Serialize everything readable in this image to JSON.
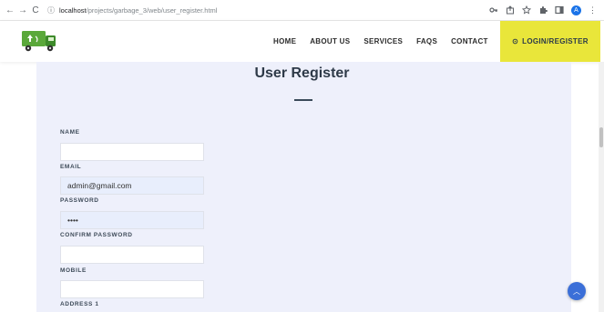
{
  "browser": {
    "back_icon": "←",
    "forward_icon": "→",
    "reload_icon": "C",
    "info_icon": "ⓘ",
    "url_host": "localhost",
    "url_path": "/projects/garbage_3/web/user_register.html",
    "icons": [
      "key",
      "share",
      "star",
      "puzzle",
      "sidebar"
    ],
    "profile_initial": "A"
  },
  "header": {
    "logo": "garbage-truck-logo",
    "nav": [
      "HOME",
      "ABOUT US",
      "SERVICES",
      "FAQS",
      "CONTACT"
    ],
    "cta_label": "LOGIN/REGISTER",
    "cta_icon": "⊙"
  },
  "form": {
    "title": "User Register",
    "fields": [
      {
        "label": "NAME",
        "value": ""
      },
      {
        "label": "EMAIL",
        "value": "admin@gmail.com"
      },
      {
        "label": "PASSWORD",
        "value": "••••"
      },
      {
        "label": "CONFIRM PASSWORD",
        "value": ""
      },
      {
        "label": "MOBILE",
        "value": ""
      },
      {
        "label": "ADDRESS 1",
        "value": ""
      }
    ]
  },
  "colors": {
    "cta_bg": "#e9e63a",
    "panel_bg": "#eef0fb",
    "to_top_bg": "#3b6fd8"
  },
  "to_top_icon": "︿"
}
